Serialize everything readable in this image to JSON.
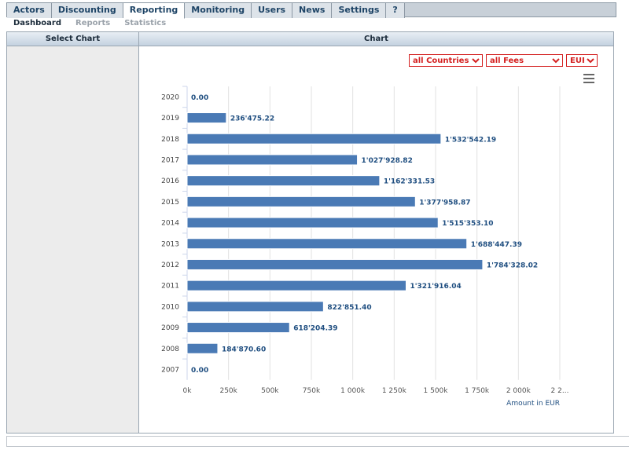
{
  "top_tabs": [
    "Actors",
    "Discounting",
    "Reporting",
    "Monitoring",
    "Users",
    "News",
    "Settings",
    "?"
  ],
  "active_tab": "Reporting",
  "sub_tabs": [
    "Dashboard",
    "Reports",
    "Statistics"
  ],
  "active_sub_tab": "Dashboard",
  "panels": {
    "side_title": "Select Chart",
    "chart_title": "Chart"
  },
  "filters": {
    "country": "all Countries",
    "fees": "all Fees",
    "currency": "EUR"
  },
  "chart_data": {
    "type": "bar",
    "orientation": "horizontal",
    "categories": [
      "2020",
      "2019",
      "2018",
      "2017",
      "2016",
      "2015",
      "2014",
      "2013",
      "2012",
      "2011",
      "2010",
      "2009",
      "2008",
      "2007"
    ],
    "values": [
      0.0,
      236475.22,
      1532542.19,
      1027928.82,
      1162331.53,
      1377958.87,
      1515353.1,
      1688447.39,
      1784328.02,
      1321916.04,
      822851.4,
      618204.39,
      184870.6,
      0.0
    ],
    "data_labels": [
      "0.00",
      "236'475.22",
      "1'532'542.19",
      "1'027'928.82",
      "1'162'331.53",
      "1'377'958.87",
      "1'515'353.10",
      "1'688'447.39",
      "1'784'328.02",
      "1'321'916.04",
      "822'851.40",
      "618'204.39",
      "184'870.60",
      "0.00"
    ],
    "xlim": [
      0,
      2250000
    ],
    "x_tick_labels": [
      "0k",
      "250k",
      "500k",
      "750k",
      "1 000k",
      "1 250k",
      "1 500k",
      "1 750k",
      "2 000k",
      "2 2..."
    ],
    "xlabel": "Amount in EUR",
    "ylabel": "",
    "grid": true,
    "bar_color": "#4a7ab5",
    "label_color": "#1f4e80"
  }
}
